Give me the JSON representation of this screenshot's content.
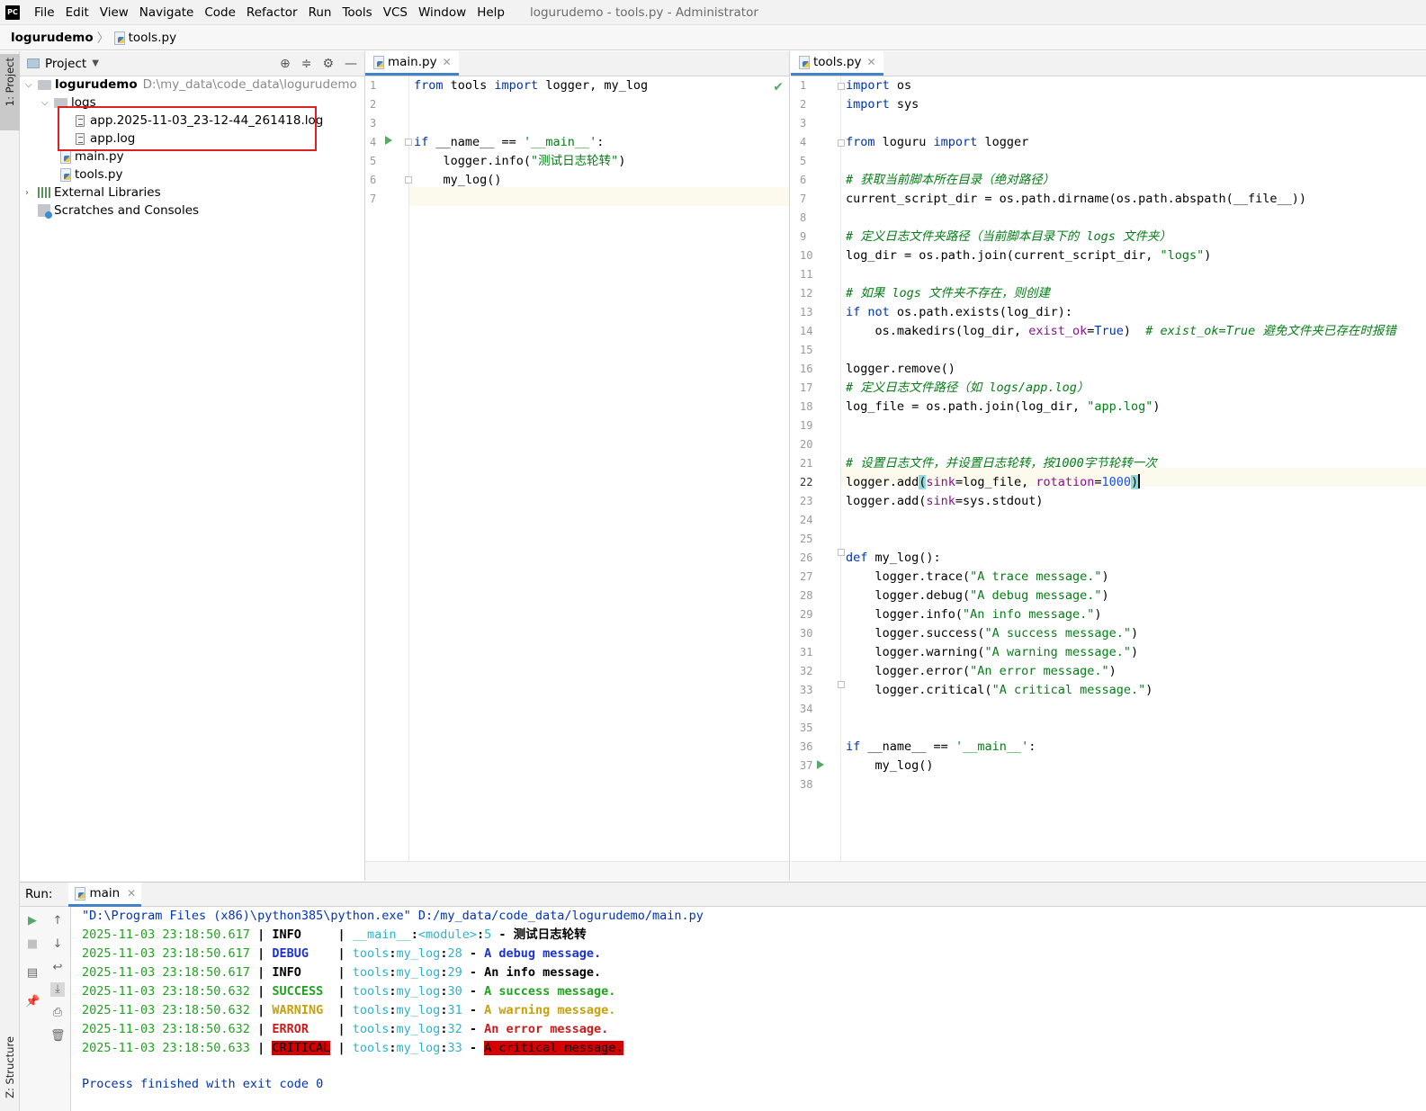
{
  "app": {
    "logo_text": "PC",
    "window_title": "logurudemo - tools.py - Administrator"
  },
  "menu": [
    "File",
    "Edit",
    "View",
    "Navigate",
    "Code",
    "Refactor",
    "Run",
    "Tools",
    "VCS",
    "Window",
    "Help"
  ],
  "breadcrumb": {
    "project": "logurudemo",
    "file": "tools.py"
  },
  "left_strip": {
    "project_label": "1: Project",
    "structure_label": "Z: Structure"
  },
  "project_panel": {
    "title": "Project",
    "tree": {
      "root_name": "logurudemo",
      "root_path": "D:\\my_data\\code_data\\logurudemo",
      "logs_folder": "logs",
      "log_file_1": "app.2025-11-03_23-12-44_261418.log",
      "log_file_2": "app.log",
      "main_file": "main.py",
      "tools_file": "tools.py",
      "external_libraries": "External Libraries",
      "scratches": "Scratches and Consoles"
    }
  },
  "editor_main": {
    "tab_label": "main.py",
    "line_numbers": [
      "1",
      "2",
      "3",
      "4",
      "5",
      "6",
      "7"
    ]
  },
  "editor_tools": {
    "tab_label": "tools.py",
    "line_numbers": [
      "1",
      "2",
      "3",
      "4",
      "5",
      "6",
      "7",
      "8",
      "9",
      "10",
      "11",
      "12",
      "13",
      "14",
      "15",
      "16",
      "17",
      "18",
      "19",
      "20",
      "21",
      "22",
      "23",
      "24",
      "25",
      "26",
      "27",
      "28",
      "29",
      "30",
      "31",
      "32",
      "33",
      "34",
      "35",
      "36",
      "37",
      "38"
    ]
  },
  "run_panel": {
    "label": "Run:",
    "tab_label": "main",
    "command": "\"D:\\Program Files (x86)\\python385\\python.exe\" D:/my_data/code_data/logurudemo/main.py",
    "log_lines": [
      {
        "time": "2025-11-03 23:18:50.617",
        "level": "INFO    ",
        "src1": "__main__",
        "src2": "<module>",
        "line": "5",
        "msg": "测试日志轮转",
        "cls": "c-plain"
      },
      {
        "time": "2025-11-03 23:18:50.617",
        "level": "DEBUG   ",
        "src1": "tools",
        "src2": "my_log",
        "line": "28",
        "msg": "A debug message.",
        "cls": "c-debug"
      },
      {
        "time": "2025-11-03 23:18:50.617",
        "level": "INFO    ",
        "src1": "tools",
        "src2": "my_log",
        "line": "29",
        "msg": "An info message.",
        "cls": "c-plain"
      },
      {
        "time": "2025-11-03 23:18:50.632",
        "level": "SUCCESS ",
        "src1": "tools",
        "src2": "my_log",
        "line": "30",
        "msg": "A success message.",
        "cls": "c-success"
      },
      {
        "time": "2025-11-03 23:18:50.632",
        "level": "WARNING ",
        "src1": "tools",
        "src2": "my_log",
        "line": "31",
        "msg": "A warning message.",
        "cls": "c-warning"
      },
      {
        "time": "2025-11-03 23:18:50.632",
        "level": "ERROR   ",
        "src1": "tools",
        "src2": "my_log",
        "line": "32",
        "msg": "An error message.",
        "cls": "c-error"
      },
      {
        "time": "2025-11-03 23:18:50.633",
        "level": "CRITICAL",
        "src1": "tools",
        "src2": "my_log",
        "line": "33",
        "msg": "A critical message.",
        "cls": "c-critical"
      }
    ],
    "finish": "Process finished with exit code 0"
  },
  "colors": {
    "accent_tab": "#4083c9",
    "keyword": "#0033b3",
    "string": "#067d17",
    "critical_bg": "#d60000",
    "selection_box": "#e02020"
  }
}
